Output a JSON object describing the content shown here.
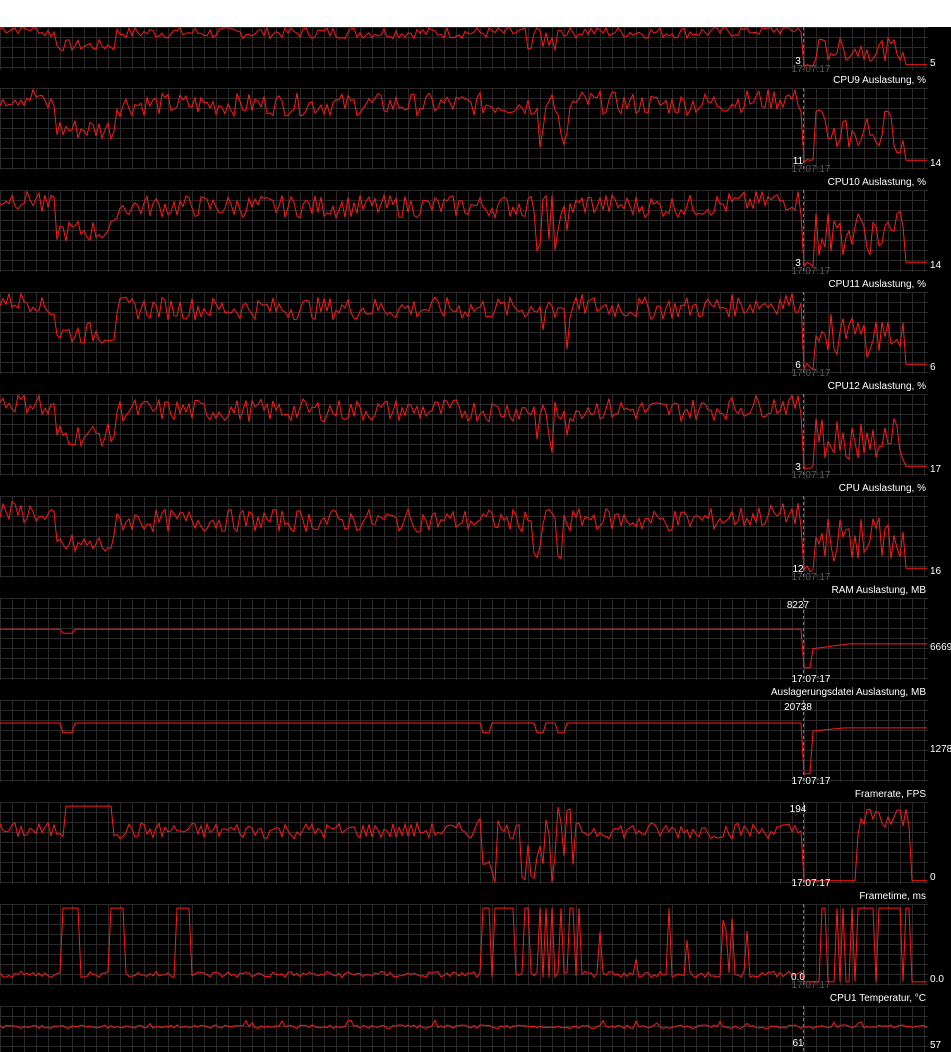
{
  "window": {
    "title_bar_color": "#ffffff"
  },
  "colors": {
    "background": "#000000",
    "grid": "#2a2a2a",
    "graph_line": "#ff1a1a",
    "marker_line": "#808080",
    "text": "#ffffff",
    "dim_text": "#5a5a5a"
  },
  "graphs": [
    {
      "title": "",
      "marker_value": "3",
      "marker_time": "17:07:17",
      "current_value": "5",
      "time_style": "dim",
      "profile": "cpu",
      "level": 0.62
    },
    {
      "title": "CPU9 Auslastung, %",
      "marker_value": "11",
      "marker_time": "17:07:17",
      "current_value": "14",
      "time_style": "dim",
      "profile": "cpu",
      "level": 0.55
    },
    {
      "title": "CPU10 Auslastung, %",
      "marker_value": "3",
      "marker_time": "17:07:17",
      "current_value": "14",
      "time_style": "dim",
      "profile": "cpu",
      "level": 0.55
    },
    {
      "title": "CPU11 Auslastung, %",
      "marker_value": "6",
      "marker_time": "17:07:17",
      "current_value": "6",
      "time_style": "dim",
      "profile": "cpu",
      "level": 0.55
    },
    {
      "title": "CPU12 Auslastung, %",
      "marker_value": "3",
      "marker_time": "17:07:17",
      "current_value": "17",
      "time_style": "dim",
      "profile": "cpu",
      "level": 0.55
    },
    {
      "title": "CPU Auslastung, %",
      "marker_value": "12",
      "marker_time": "17:07:17",
      "current_value": "16",
      "time_style": "dim",
      "profile": "cpu_total",
      "level": 0.45
    },
    {
      "title": "RAM Auslastung, MB",
      "marker_value": "8227",
      "marker_time": "17:07:17",
      "current_value": "6669",
      "time_style": "bright",
      "profile": "ram",
      "level": 0.62
    },
    {
      "title": "Auslagerungsdatei Auslastung, MB",
      "marker_value": "20738",
      "marker_time": "17:07:17",
      "current_value": "1278",
      "time_style": "bright",
      "profile": "swap",
      "level": 0.32
    },
    {
      "title": "Framerate, FPS",
      "marker_value": "194",
      "marker_time": "17:07:17",
      "current_value": "0",
      "time_style": "bright",
      "profile": "fps",
      "level": 0.3
    },
    {
      "title": "Frametime, ms",
      "marker_value": "0.0",
      "marker_time": "17:07:17",
      "current_value": "0.0",
      "time_style": "dim",
      "profile": "frametime",
      "level": 0.8
    },
    {
      "title": "CPU1 Temperatur, °C",
      "marker_value": "61",
      "marker_time": "",
      "current_value": "57",
      "time_style": "dim",
      "profile": "temp",
      "level": 0.4
    }
  ]
}
